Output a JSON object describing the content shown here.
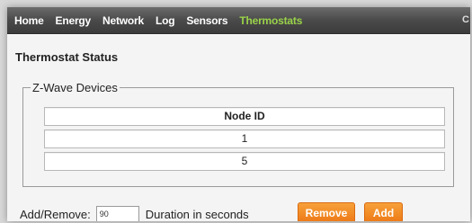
{
  "nav": {
    "items": [
      "Home",
      "Energy",
      "Network",
      "Log",
      "Sensors",
      "Thermostats"
    ],
    "active_index": 5,
    "edge_glyph": "C"
  },
  "page": {
    "title": "Thermostat Status"
  },
  "devices": {
    "legend": "Z-Wave Devices",
    "column_header": "Node ID",
    "rows": [
      "1",
      "5"
    ]
  },
  "controls": {
    "add_remove_label": "Add/Remove:",
    "duration_value": "90",
    "duration_label": "Duration in seconds",
    "remove_label": "Remove",
    "add_label": "Add"
  },
  "colors": {
    "nav_active": "#9ad34a",
    "button_orange": "#f08a20"
  }
}
